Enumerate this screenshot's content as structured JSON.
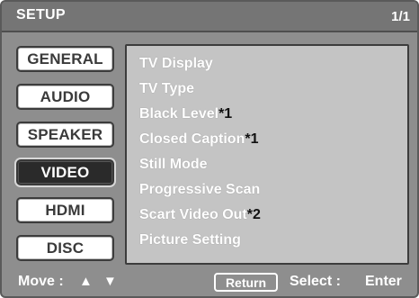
{
  "header": {
    "title": "SETUP",
    "page": "1/1"
  },
  "tabs": [
    {
      "label": "GENERAL",
      "selected": false
    },
    {
      "label": "AUDIO",
      "selected": false
    },
    {
      "label": "SPEAKER",
      "selected": false
    },
    {
      "label": "VIDEO",
      "selected": true
    },
    {
      "label": "HDMI",
      "selected": false
    },
    {
      "label": "DISC",
      "selected": false
    }
  ],
  "items": [
    {
      "label": "TV Display",
      "note": ""
    },
    {
      "label": "TV Type",
      "note": ""
    },
    {
      "label": "Black Level",
      "note": "*1"
    },
    {
      "label": "Closed Caption",
      "note": "*1"
    },
    {
      "label": "Still Mode",
      "note": ""
    },
    {
      "label": "Progressive Scan",
      "note": ""
    },
    {
      "label": "Scart Video Out",
      "note": "*2"
    },
    {
      "label": "Picture Setting",
      "note": ""
    }
  ],
  "footer": {
    "move_label": "Move :",
    "move_arrows": "▲ ▼",
    "return_label": "Return",
    "select_label": "Select :",
    "enter_label": "Enter"
  },
  "icons": {
    "move_arrows": "up-down-arrows-icon"
  },
  "colors": {
    "panel_background": "#8e8e8e",
    "title_bar": "#757575",
    "content_background": "#c4c4c4",
    "selected_tab": "#2a2a2a",
    "text": "#ffffff"
  }
}
